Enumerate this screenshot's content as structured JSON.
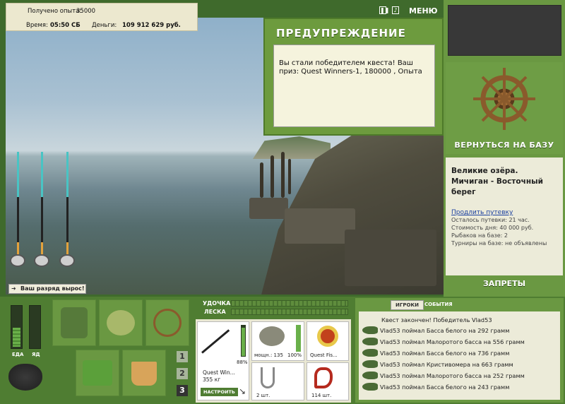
{
  "stats": {
    "experience_label": "Получено опыта:",
    "experience_value": "35000",
    "time_label": "Время:",
    "time_value": "05:50 СБ",
    "money_label": "Деньги:",
    "money_value": "109 912 629 руб."
  },
  "top_controls": {
    "pause_icon": "pause-icon",
    "sound_icon": "sound-icon",
    "menu_label": "МЕНЮ"
  },
  "warning": {
    "title": "ПРЕДУПРЕЖДЕНИЕ",
    "message": "Вы стали победителем квеста! Ваш приз: Quest Winners-1, 180000 , Опыта"
  },
  "right_panel": {
    "return_label": "ВЕРНУТЬСЯ НА БАЗУ",
    "location": "Великие озёра. Мичиган - Восточный берег",
    "extend_link": "Продлить путевку",
    "lines": [
      "Осталось путевки: 21 час.",
      "Стоимость дня: 40 000 руб.",
      "Рыбаков на базе: 2",
      "Турниры на базе: не объявлены"
    ],
    "bans_label": "ЗАПРЕТЫ"
  },
  "scene": {
    "notice": "Ваш разряд вырос!"
  },
  "status_bars": {
    "food_label": "ЕДА",
    "poison_label": "ЯД",
    "food_level": 0.45,
    "poison_level": 0.0
  },
  "inventory_pages": [
    "1",
    "2",
    "3"
  ],
  "tackle": {
    "rod_label": "УДОЧКА",
    "line_label": "ЛЕСКА",
    "rod_name": "Quest Win...",
    "rod_weight": "355 кг",
    "rod_percent": "88%",
    "reel_power": "мощн.: 135",
    "reel_percent": "100%",
    "line_name": "Quest Fis...",
    "hook_count": "2 шт.",
    "bait_count": "114 шт.",
    "setup_label": "НАСТРОИТЬ"
  },
  "feed": {
    "tabs": [
      "ИГРОКИ",
      "СОБЫТИЯ"
    ],
    "header": "Квест закончен! Победитель Vlad53",
    "entries": [
      "Vlad53 поймал Басса белого на 292 грамм",
      "Vlad53 поймал Малоротого басса на 556 грамм",
      "Vlad53 поймал Басса белого на 736 грамм",
      "Vlad53 поймал Кристивомера на 663 грамм",
      "Vlad53 поймал Малоротого басса на 252 грамм",
      "Vlad53 поймал Басса белого на 243 грамм"
    ]
  }
}
